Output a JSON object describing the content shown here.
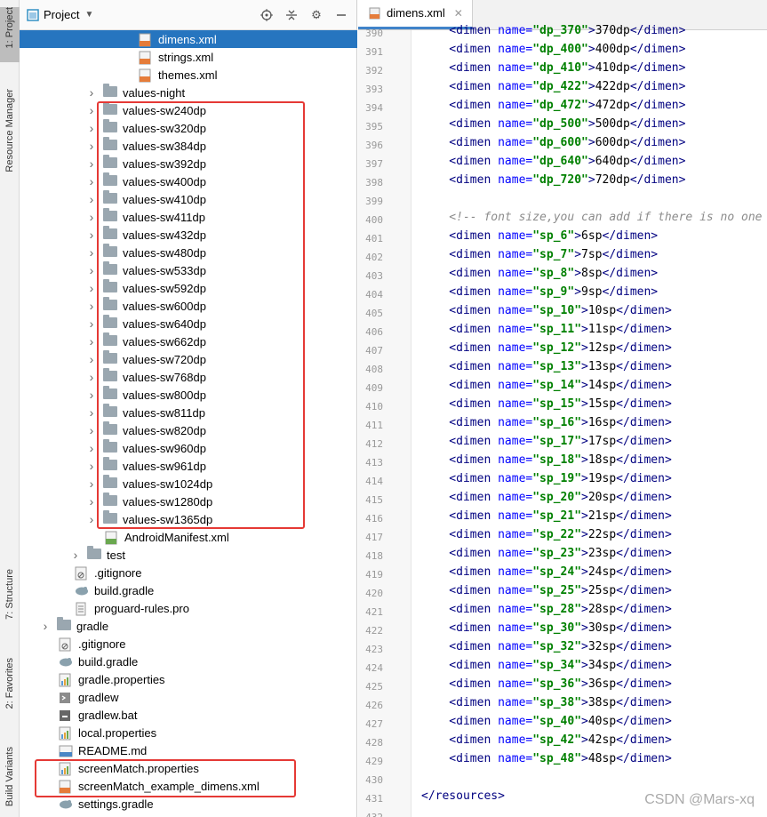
{
  "side_tabs": [
    {
      "label": "1: Project",
      "active": true
    },
    {
      "label": "Resource Manager",
      "active": false
    },
    {
      "label": "7: Structure",
      "active": false
    },
    {
      "label": "2: Favorites",
      "active": false
    },
    {
      "label": "Build Variants",
      "active": false
    }
  ],
  "project_panel": {
    "title": "Project",
    "tree": [
      {
        "label": "dimens.xml",
        "icon": "xml-file-icon",
        "selected": true
      },
      {
        "label": "strings.xml",
        "icon": "xml-file-icon"
      },
      {
        "label": "themes.xml",
        "icon": "xml-file-icon"
      },
      {
        "label": "values-night",
        "icon": "folder-icon"
      },
      {
        "label": "values-sw240dp",
        "icon": "folder-icon"
      },
      {
        "label": "values-sw320dp",
        "icon": "folder-icon"
      },
      {
        "label": "values-sw384dp",
        "icon": "folder-icon"
      },
      {
        "label": "values-sw392dp",
        "icon": "folder-icon"
      },
      {
        "label": "values-sw400dp",
        "icon": "folder-icon"
      },
      {
        "label": "values-sw410dp",
        "icon": "folder-icon"
      },
      {
        "label": "values-sw411dp",
        "icon": "folder-icon"
      },
      {
        "label": "values-sw432dp",
        "icon": "folder-icon"
      },
      {
        "label": "values-sw480dp",
        "icon": "folder-icon"
      },
      {
        "label": "values-sw533dp",
        "icon": "folder-icon"
      },
      {
        "label": "values-sw592dp",
        "icon": "folder-icon"
      },
      {
        "label": "values-sw600dp",
        "icon": "folder-icon"
      },
      {
        "label": "values-sw640dp",
        "icon": "folder-icon"
      },
      {
        "label": "values-sw662dp",
        "icon": "folder-icon"
      },
      {
        "label": "values-sw720dp",
        "icon": "folder-icon"
      },
      {
        "label": "values-sw768dp",
        "icon": "folder-icon"
      },
      {
        "label": "values-sw800dp",
        "icon": "folder-icon"
      },
      {
        "label": "values-sw811dp",
        "icon": "folder-icon"
      },
      {
        "label": "values-sw820dp",
        "icon": "folder-icon"
      },
      {
        "label": "values-sw960dp",
        "icon": "folder-icon"
      },
      {
        "label": "values-sw961dp",
        "icon": "folder-icon"
      },
      {
        "label": "values-sw1024dp",
        "icon": "folder-icon"
      },
      {
        "label": "values-sw1280dp",
        "icon": "folder-icon"
      },
      {
        "label": "values-sw1365dp",
        "icon": "folder-icon"
      },
      {
        "label": "AndroidManifest.xml",
        "icon": "manifest-file-icon"
      },
      {
        "label": "test",
        "icon": "folder-icon"
      },
      {
        "label": ".gitignore",
        "icon": "gitignore-file-icon"
      },
      {
        "label": "build.gradle",
        "icon": "gradle-file-icon"
      },
      {
        "label": "proguard-rules.pro",
        "icon": "text-file-icon"
      },
      {
        "label": "gradle",
        "icon": "folder-icon"
      },
      {
        "label": ".gitignore",
        "icon": "gitignore-file-icon"
      },
      {
        "label": "build.gradle",
        "icon": "gradle-file-icon"
      },
      {
        "label": "gradle.properties",
        "icon": "properties-file-icon"
      },
      {
        "label": "gradlew",
        "icon": "shell-file-icon"
      },
      {
        "label": "gradlew.bat",
        "icon": "bat-file-icon"
      },
      {
        "label": "local.properties",
        "icon": "properties-file-icon"
      },
      {
        "label": "README.md",
        "icon": "markdown-file-icon"
      },
      {
        "label": "screenMatch.properties",
        "icon": "properties-file-icon"
      },
      {
        "label": "screenMatch_example_dimens.xml",
        "icon": "xml-file-icon"
      },
      {
        "label": "settings.gradle",
        "icon": "gradle-file-icon"
      }
    ]
  },
  "editor": {
    "tab_label": "dimens.xml",
    "lines": [
      {
        "n": "390",
        "kind": "dimen",
        "name": "dp_370",
        "value": "370dp"
      },
      {
        "n": "391",
        "kind": "dimen",
        "name": "dp_400",
        "value": "400dp"
      },
      {
        "n": "392",
        "kind": "dimen",
        "name": "dp_410",
        "value": "410dp"
      },
      {
        "n": "393",
        "kind": "dimen",
        "name": "dp_422",
        "value": "422dp"
      },
      {
        "n": "394",
        "kind": "dimen",
        "name": "dp_472",
        "value": "472dp"
      },
      {
        "n": "395",
        "kind": "dimen",
        "name": "dp_500",
        "value": "500dp"
      },
      {
        "n": "396",
        "kind": "dimen",
        "name": "dp_600",
        "value": "600dp"
      },
      {
        "n": "397",
        "kind": "dimen",
        "name": "dp_640",
        "value": "640dp"
      },
      {
        "n": "398",
        "kind": "dimen",
        "name": "dp_720",
        "value": "720dp"
      },
      {
        "n": "399",
        "kind": "blank"
      },
      {
        "n": "400",
        "kind": "comment",
        "text": "<!-- font size,you can add if there is no one"
      },
      {
        "n": "401",
        "kind": "dimen",
        "name": "sp_6",
        "value": "6sp"
      },
      {
        "n": "402",
        "kind": "dimen",
        "name": "sp_7",
        "value": "7sp"
      },
      {
        "n": "403",
        "kind": "dimen",
        "name": "sp_8",
        "value": "8sp"
      },
      {
        "n": "404",
        "kind": "dimen",
        "name": "sp_9",
        "value": "9sp"
      },
      {
        "n": "405",
        "kind": "dimen",
        "name": "sp_10",
        "value": "10sp"
      },
      {
        "n": "406",
        "kind": "dimen",
        "name": "sp_11",
        "value": "11sp"
      },
      {
        "n": "407",
        "kind": "dimen",
        "name": "sp_12",
        "value": "12sp"
      },
      {
        "n": "408",
        "kind": "dimen",
        "name": "sp_13",
        "value": "13sp"
      },
      {
        "n": "409",
        "kind": "dimen",
        "name": "sp_14",
        "value": "14sp"
      },
      {
        "n": "410",
        "kind": "dimen",
        "name": "sp_15",
        "value": "15sp"
      },
      {
        "n": "411",
        "kind": "dimen",
        "name": "sp_16",
        "value": "16sp"
      },
      {
        "n": "412",
        "kind": "dimen",
        "name": "sp_17",
        "value": "17sp"
      },
      {
        "n": "413",
        "kind": "dimen",
        "name": "sp_18",
        "value": "18sp"
      },
      {
        "n": "414",
        "kind": "dimen",
        "name": "sp_19",
        "value": "19sp"
      },
      {
        "n": "415",
        "kind": "dimen",
        "name": "sp_20",
        "value": "20sp"
      },
      {
        "n": "416",
        "kind": "dimen",
        "name": "sp_21",
        "value": "21sp"
      },
      {
        "n": "417",
        "kind": "dimen",
        "name": "sp_22",
        "value": "22sp"
      },
      {
        "n": "418",
        "kind": "dimen",
        "name": "sp_23",
        "value": "23sp"
      },
      {
        "n": "419",
        "kind": "dimen",
        "name": "sp_24",
        "value": "24sp"
      },
      {
        "n": "420",
        "kind": "dimen",
        "name": "sp_25",
        "value": "25sp"
      },
      {
        "n": "421",
        "kind": "dimen",
        "name": "sp_28",
        "value": "28sp"
      },
      {
        "n": "422",
        "kind": "dimen",
        "name": "sp_30",
        "value": "30sp"
      },
      {
        "n": "423",
        "kind": "dimen",
        "name": "sp_32",
        "value": "32sp"
      },
      {
        "n": "424",
        "kind": "dimen",
        "name": "sp_34",
        "value": "34sp"
      },
      {
        "n": "425",
        "kind": "dimen",
        "name": "sp_36",
        "value": "36sp"
      },
      {
        "n": "426",
        "kind": "dimen",
        "name": "sp_38",
        "value": "38sp"
      },
      {
        "n": "427",
        "kind": "dimen",
        "name": "sp_40",
        "value": "40sp"
      },
      {
        "n": "428",
        "kind": "dimen",
        "name": "sp_42",
        "value": "42sp"
      },
      {
        "n": "429",
        "kind": "dimen",
        "name": "sp_48",
        "value": "48sp"
      },
      {
        "n": "430",
        "kind": "blank"
      },
      {
        "n": "431",
        "kind": "close",
        "text": "</resources>"
      },
      {
        "n": "432",
        "kind": "blank"
      }
    ]
  },
  "watermark": "CSDN @Mars-xq",
  "colors": {
    "selection": "#2675bf",
    "highlight_box": "#e53935",
    "tab_underline": "#4083c9"
  }
}
